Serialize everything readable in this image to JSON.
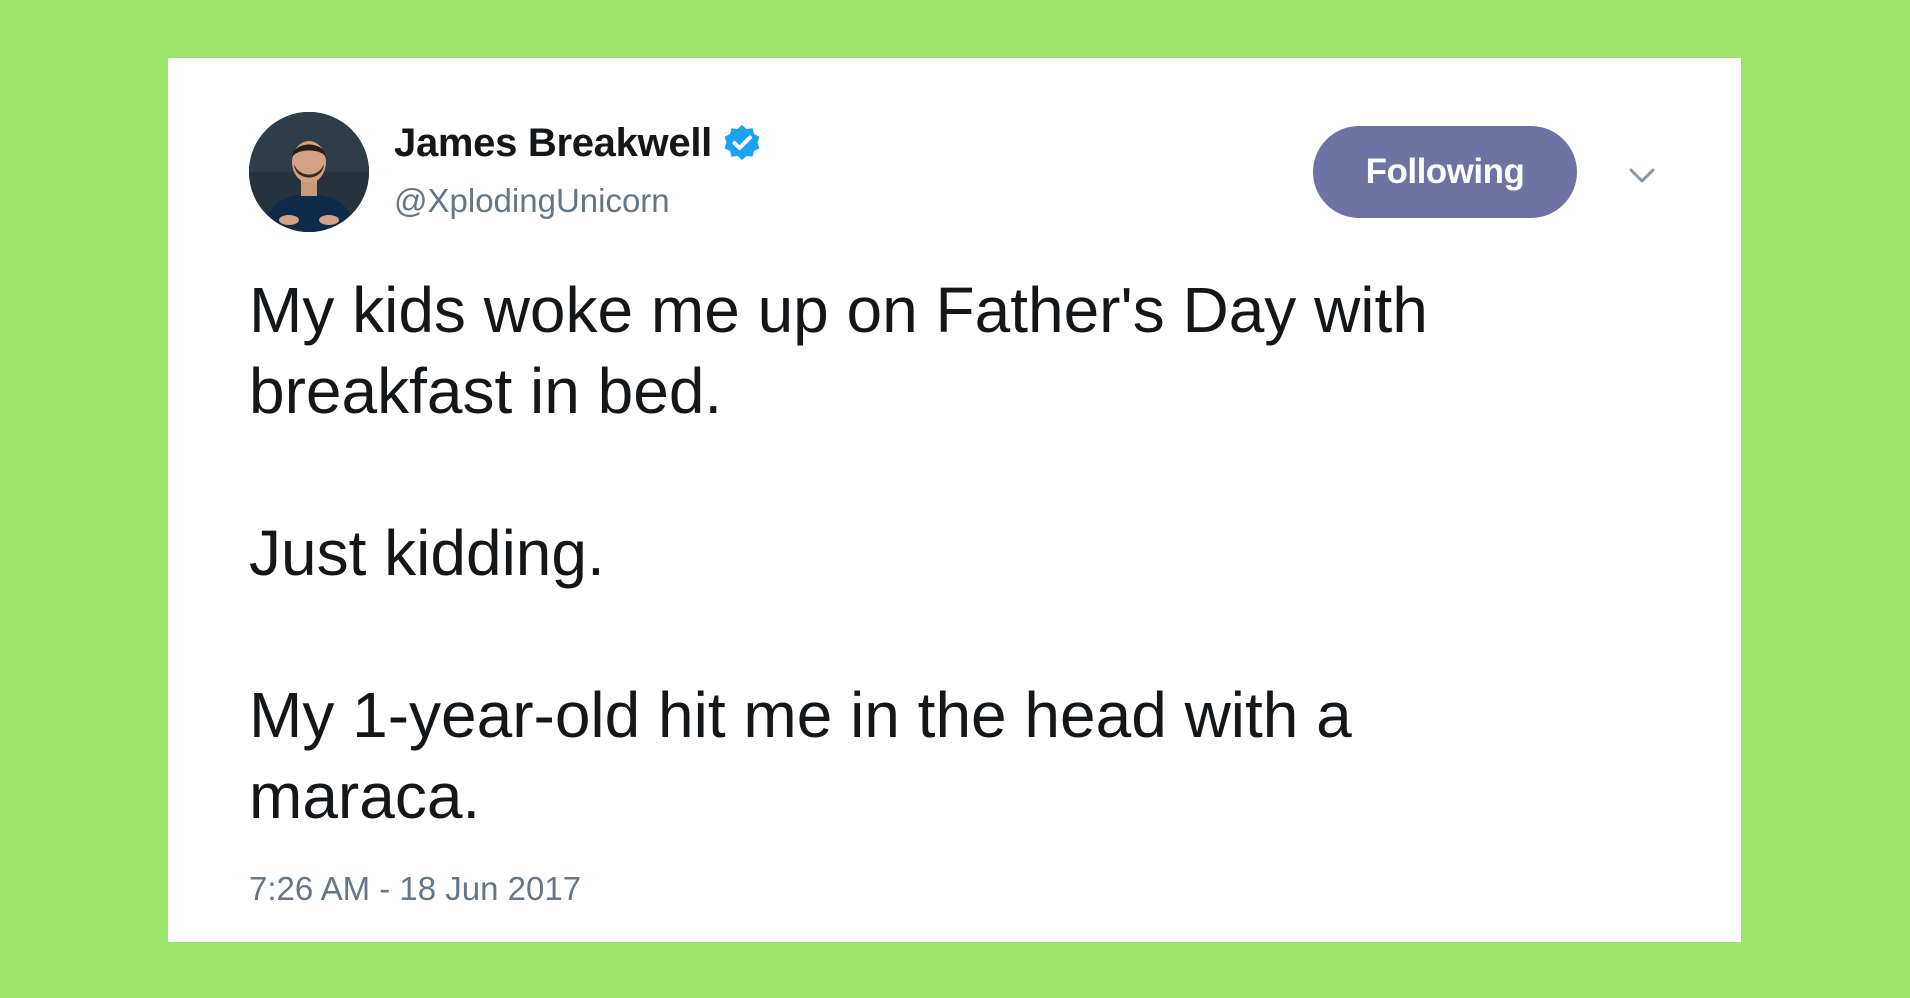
{
  "colors": {
    "background": "#9be36a",
    "card": "#ffffff",
    "follow_button": "#6f73a3",
    "verified_badge": "#1da1f2",
    "secondary_text": "#657786",
    "primary_text": "#14171a"
  },
  "tweet": {
    "author": {
      "display_name": "James Breakwell",
      "handle": "@XplodingUnicorn",
      "verified": true,
      "avatar_icon": "profile-photo",
      "verified_icon": "verified-badge-icon"
    },
    "follow_button_label": "Following",
    "menu_icon": "chevron-down-icon",
    "text": "My kids woke me up on Father's Day with\nbreakfast in bed.\n\nJust kidding.\n\nMy 1-year-old hit me in the head with a\nmaraca.",
    "timestamp": "7:26 AM - 18 Jun 2017"
  }
}
